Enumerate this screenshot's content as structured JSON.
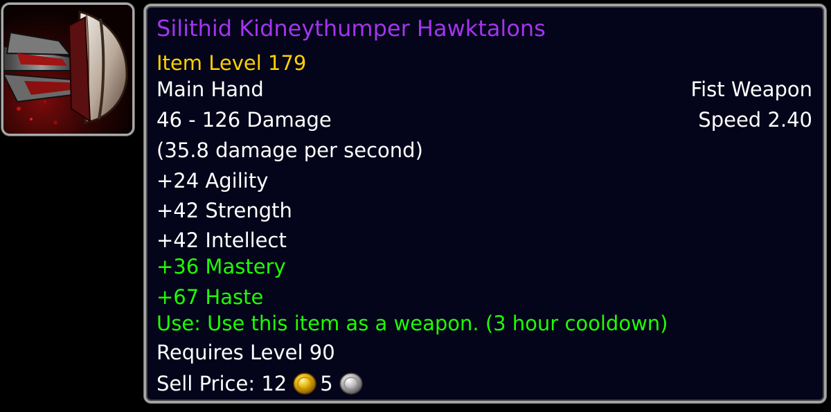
{
  "item": {
    "name": "Silithid Kidneythumper Hawktalons",
    "item_level": "Item Level 179",
    "slot": "Main Hand",
    "type": "Fist Weapon",
    "damage": "46 - 126 Damage",
    "speed": "Speed 2.40",
    "dps": "(35.8 damage per second)",
    "stats": {
      "agility": "+24 Agility",
      "strength": "+42 Strength",
      "intellect": "+42 Intellect",
      "mastery": "+36 Mastery",
      "haste": "+67 Haste"
    },
    "use_effect": "Use: Use this item as a weapon. (3 hour cooldown)",
    "requires": "Requires Level 90",
    "sell_price": {
      "label": "Sell Price: ",
      "gold": "12",
      "silver": "5"
    }
  },
  "colors": {
    "epic": "#a335ee",
    "item_level": "#ffd100",
    "green": "#1eff00",
    "text": "#ffffff",
    "background": "#04041a"
  },
  "icons": {
    "item_icon": "fist-weapon-icon",
    "gold": "gold-coin-icon",
    "silver": "silver-coin-icon"
  }
}
